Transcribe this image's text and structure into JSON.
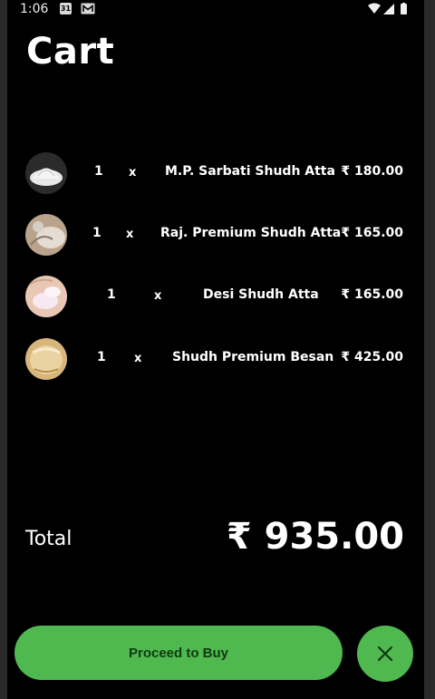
{
  "status_bar": {
    "time": "1:06",
    "calendar_day": "31"
  },
  "page": {
    "title": "Cart"
  },
  "cart": {
    "items": [
      {
        "qty": "1",
        "times": "x",
        "name": "M.P. Sarbati Shudh Atta",
        "price": "₹ 180.00"
      },
      {
        "qty": "1",
        "times": "x",
        "name": "Raj. Premium Shudh Atta",
        "price": "₹ 165.00"
      },
      {
        "qty": "1",
        "times": "x",
        "name": "Desi Shudh Atta",
        "price": "₹ 165.00"
      },
      {
        "qty": "1",
        "times": "x",
        "name": "Shudh Premium Besan",
        "price": "₹ 425.00"
      }
    ],
    "total_label": "Total",
    "total_amount": "₹ 935.00"
  },
  "actions": {
    "proceed_label": "Proceed to Buy"
  },
  "colors": {
    "accent": "#4fb84f",
    "background": "#000000",
    "text": "#ffffff"
  }
}
